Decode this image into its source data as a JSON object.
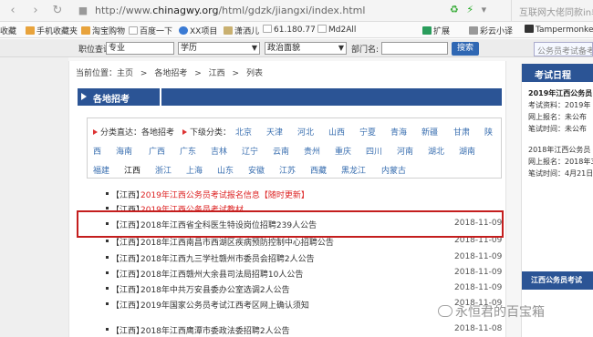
{
  "browser": {
    "url_prefix": "http://www.",
    "url_domain": "chinagwy.org",
    "url_path": "/html/gdzk/jiangxi/index.html",
    "search_tab": "互联网大佬同款in单品",
    "bookmarks": [
      "收藏",
      "手机收藏夹",
      "淘宝购物",
      "百度一下",
      "XX项目",
      "潇洒儿",
      "61.180.77",
      "Md2All",
      "扩展",
      "彩云小译",
      "Tampermonkey"
    ]
  },
  "query": {
    "job_label": "职位查询:",
    "job_value": "专业",
    "edu_value": "学历",
    "politics_value": "政治面貌",
    "dept_label": "部门名:",
    "dept_value": "",
    "search_btn": "搜索",
    "right_tab": "公务员考试备考"
  },
  "breadcrumb": [
    "当前位置：主页",
    ">",
    "各地招考",
    ">",
    "江西",
    ">",
    "列表"
  ],
  "section_title": "各地招考",
  "filter": {
    "category_label": "分类直达：各地招考",
    "level_label": "下级分类：",
    "regions_row1": [
      "北京",
      "天津",
      "河北",
      "山西",
      "宁夏",
      "青海",
      "新疆",
      "甘肃",
      "陕"
    ],
    "regions_row2": [
      "西",
      "海南",
      "广西",
      "广东",
      "吉林",
      "辽宁",
      "云南",
      "贵州",
      "重庆",
      "四川",
      "河南",
      "湖北",
      "湖南"
    ],
    "regions_row3": [
      "福建",
      "江西",
      "浙江",
      "上海",
      "山东",
      "安徽",
      "江苏",
      "西藏",
      "黑龙江",
      "内蒙古"
    ],
    "current_region": "江西"
  },
  "list": [
    {
      "tag": "【江西】",
      "title": "2019年江西公务员考试报名信息【随时更新】",
      "date": "",
      "red": true
    },
    {
      "tag": "【江西】",
      "title": "2019年江西公务员考试教材",
      "date": "",
      "red": true
    },
    {
      "tag": "【江西】",
      "title": "2018年江西省全科医生特设岗位招聘239人公告",
      "date": "2018-11-09",
      "red": false
    },
    {
      "tag": "【江西】",
      "title": "2018年江西南昌市西湖区疾病预防控制中心招聘公告",
      "date": "2018-11-09",
      "red": false
    },
    {
      "tag": "【江西】",
      "title": "2018年江西九三学社赣州市委员会招聘2人公告",
      "date": "2018-11-09",
      "red": false
    },
    {
      "tag": "【江西】",
      "title": "2018年江西赣州大余县司法局招聘10人公告",
      "date": "2018-11-09",
      "red": false
    },
    {
      "tag": "【江西】",
      "title": "2018年中共万安县委办公室选调2人公告",
      "date": "2018-11-09",
      "red": false
    },
    {
      "tag": "【江西】",
      "title": "2019年国家公务员考试江西考区网上确认须知",
      "date": "2018-11-09",
      "red": false
    },
    {
      "tag": "【江西】",
      "title": "2018年江西鹰潭市委政法委招聘2人公告",
      "date": "2018-11-08",
      "red": false
    }
  ],
  "sidebar": {
    "title": "考试日程",
    "entries": [
      {
        "text": "2019年江西公务员",
        "bold": true
      },
      {
        "text": "考试资料：2019年",
        "bold": false
      },
      {
        "text": "网上报名：未公布",
        "bold": false
      },
      {
        "text": "笔试时间：未公布",
        "bold": false
      },
      {
        "text": "2018年江西公务员",
        "bold": false
      },
      {
        "text": "网上报名：2018年3",
        "bold": false
      },
      {
        "text": "笔试时间：4月21日",
        "bold": false
      }
    ],
    "footer": "江西公务员考试"
  },
  "watermark": "永恒君的百宝箱"
}
